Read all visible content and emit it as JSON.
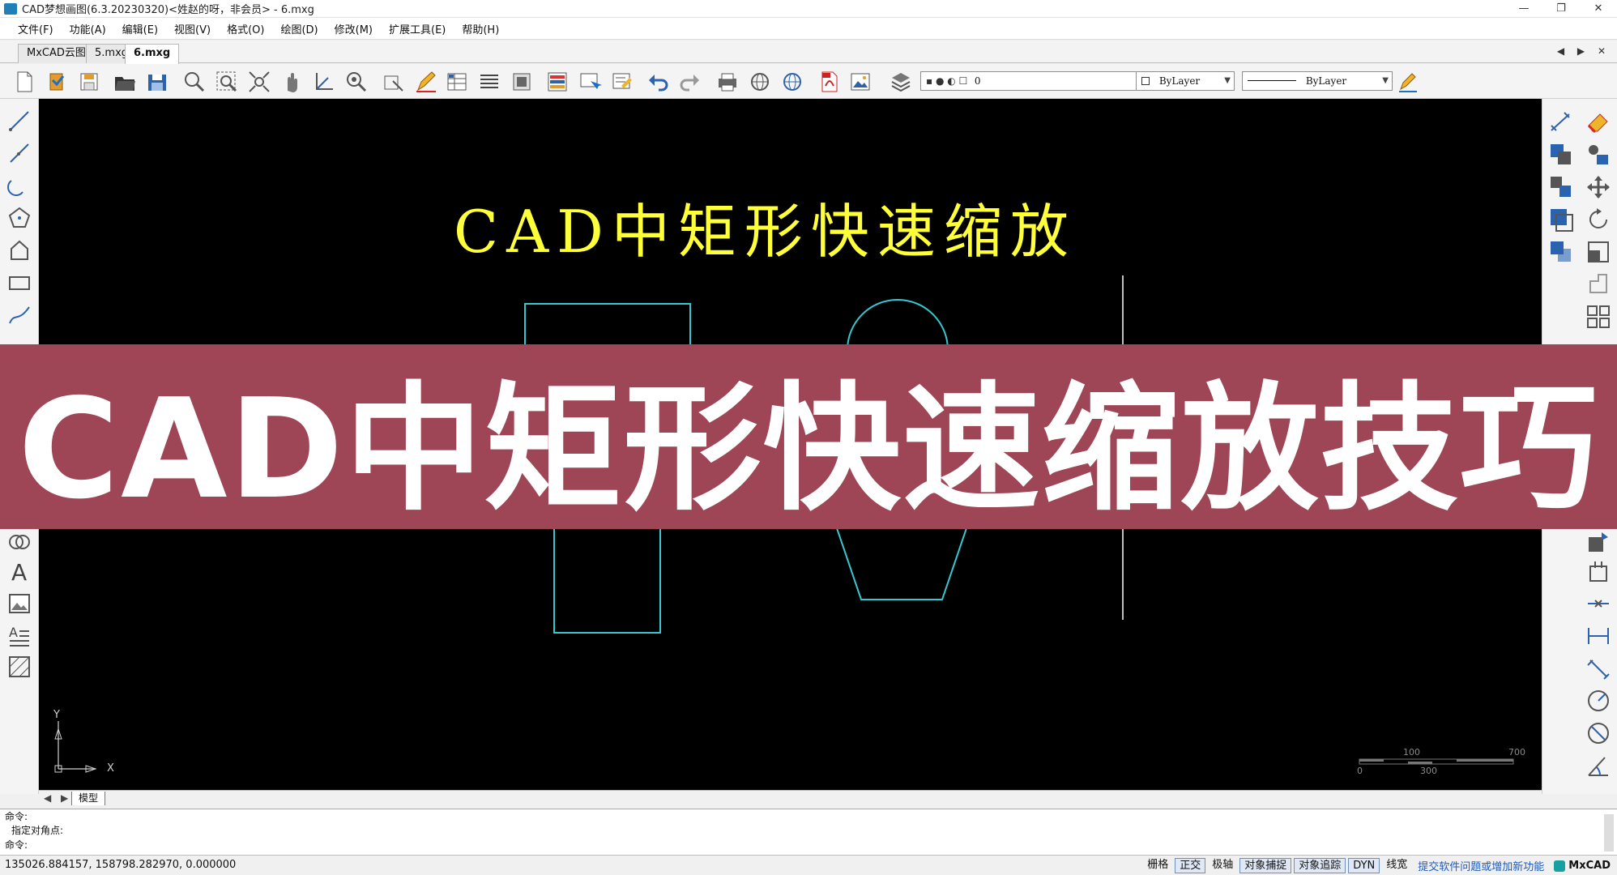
{
  "window": {
    "title": "CAD梦想画图(6.3.20230320)<姓赵的呀，非会员> - 6.mxg",
    "minimize_glyph": "—",
    "restore_glyph": "❐",
    "close_glyph": "✕"
  },
  "menu": [
    "文件(F)",
    "功能(A)",
    "编辑(E)",
    "视图(V)",
    "格式(O)",
    "绘图(D)",
    "修改(M)",
    "扩展工具(E)",
    "帮助(H)"
  ],
  "tabs": [
    "MxCAD云图",
    "5.mxg",
    "6.mxg"
  ],
  "tab_nav": "◀ ▶ ✕",
  "toolbar": {
    "layer_value": "0",
    "color_value": "ByLayer",
    "linetype_value": "ByLayer"
  },
  "drawing": {
    "title": "CAD中矩形快速缩放",
    "ucs_x": "X",
    "ucs_y": "Y",
    "scale_labels": [
      "100",
      "700",
      "0",
      "300"
    ],
    "colors": {
      "entity": "#35c8d0",
      "text": "#ffff3a",
      "line": "#ffffff",
      "background": "#000000"
    }
  },
  "overlay": {
    "banner_text": "CAD中矩形快速缩放技巧",
    "banner_color": "#9e4556"
  },
  "layout_tabs": {
    "nav": "◀ ▶",
    "model": "模型"
  },
  "command": {
    "lines": [
      "命令:",
      "指定对角点:",
      "命令:"
    ]
  },
  "status": {
    "coords": "135026.884157,  158798.282970,  0.000000",
    "toggles": [
      {
        "label": "栅格",
        "on": false
      },
      {
        "label": "正交",
        "on": true
      },
      {
        "label": "极轴",
        "on": false
      },
      {
        "label": "对象捕捉",
        "on": true
      },
      {
        "label": "对象追踪",
        "on": true
      },
      {
        "label": "DYN",
        "on": true
      },
      {
        "label": "线宽",
        "on": false
      }
    ],
    "feedback_link": "提交软件问题或增加新功能",
    "brand": "MxCAD"
  }
}
